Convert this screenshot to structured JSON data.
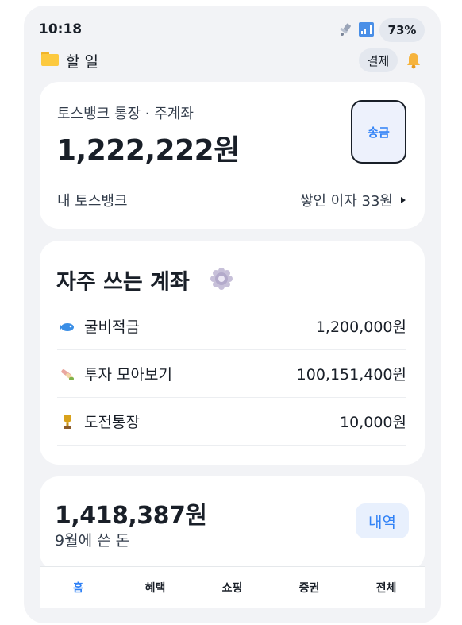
{
  "status": {
    "time": "10:18",
    "battery": "73%"
  },
  "header": {
    "todo": "할 일",
    "pay": "결제"
  },
  "bank": {
    "name": "토스뱅크 통장 · 주계좌",
    "balance": "1,222,222원",
    "send": "송금",
    "my_bank": "내 토스뱅크",
    "interest": "쌓인 이자 33원"
  },
  "frequent": {
    "title": "자주 쓰는 계좌",
    "items": [
      {
        "label": "굴비적금",
        "amount": "1,200,000원",
        "icon": "fish-icon"
      },
      {
        "label": "투자 모아보기",
        "amount": "100,151,400원",
        "icon": "ingredients-icon"
      },
      {
        "label": "도전통장",
        "amount": "10,000원",
        "icon": "trophy-icon"
      }
    ]
  },
  "spent": {
    "amount": "1,418,387원",
    "label": "9월에 쓴 돈",
    "history": "내역"
  },
  "tabs": [
    "홈",
    "혜택",
    "쇼핑",
    "증권",
    "전체"
  ],
  "colors": {
    "accent": "#3182f6",
    "background": "#f2f3f6",
    "card": "#ffffff"
  }
}
